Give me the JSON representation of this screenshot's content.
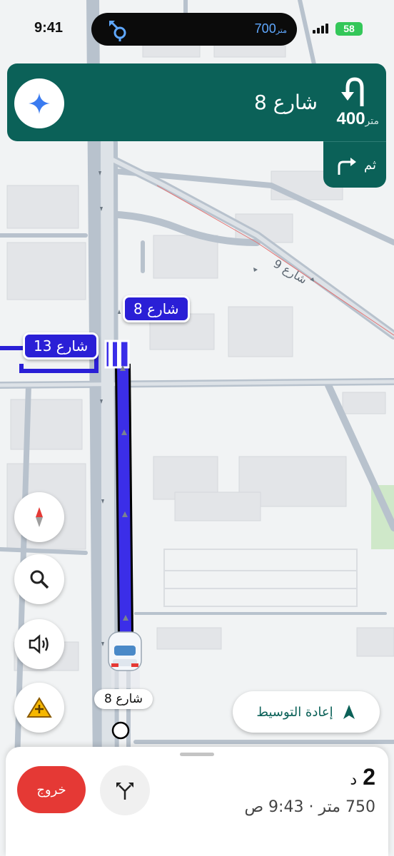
{
  "status_bar": {
    "time": "9:41",
    "island_distance": "700",
    "island_unit": "متر",
    "battery": "58"
  },
  "navigation": {
    "street": "شارع 8",
    "distance_value": "400",
    "distance_unit": "متر",
    "then_label": "ثم"
  },
  "map": {
    "route_labels": [
      "شارع 8",
      "شارع 13"
    ],
    "current_street": "شارع 8",
    "road_label": "شارع 9"
  },
  "controls": {
    "recenter_label": "إعادة التوسيط"
  },
  "bottom_sheet": {
    "exit_label": "خروج",
    "eta_value": "2",
    "eta_unit": "د",
    "details": "750 متر · 9:43 ص"
  },
  "colors": {
    "banner": "#0b6158",
    "route": "#2a1fd6",
    "exit": "#e53935",
    "battery": "#34c759"
  }
}
